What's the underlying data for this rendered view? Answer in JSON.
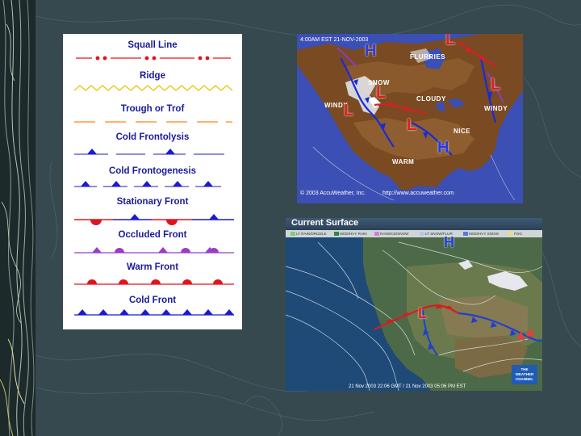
{
  "legend": {
    "items": [
      {
        "label": "Squall Line"
      },
      {
        "label": "Ridge"
      },
      {
        "label": "Trough or Trof"
      },
      {
        "label": "Cold Frontolysis"
      },
      {
        "label": "Cold Frontogenesis"
      },
      {
        "label": "Stationary Front"
      },
      {
        "label": "Occluded Front"
      },
      {
        "label": "Warm Front"
      },
      {
        "label": "Cold Front"
      }
    ],
    "colors": {
      "label": "#1a1a9a",
      "red": "#e0141e",
      "blue": "#1a1ad0",
      "purple": "#9a3cc8",
      "orange": "#ff9a3c",
      "yellow": "#e8c800"
    }
  },
  "map1": {
    "timestamp": "4:00AM EST 21-NOV-2003",
    "labels": [
      "FLURRIES",
      "SNOW",
      "WINDY",
      "CLOUDY",
      "WINDY",
      "NICE",
      "WARM"
    ],
    "copyright": "© 2003 AccuWeather, Inc.",
    "url": "http://www.accuweather.com",
    "pressure_symbols": [
      "H",
      "L",
      "L",
      "L",
      "L",
      "L",
      "H"
    ]
  },
  "map2": {
    "title": "Current Surface",
    "legend_items": [
      {
        "label": "LT RAIN/DRIZZLE",
        "color": "#7ad06e"
      },
      {
        "label": "MOD/HVY RAIN",
        "color": "#2c8a34"
      },
      {
        "label": "RAIN/ICE/SNOW",
        "color": "#d87ad8"
      },
      {
        "label": "LT SNOW/FLUR",
        "color": "#b0c8ee"
      },
      {
        "label": "MOD/HVY SNOW",
        "color": "#5a7ad8"
      },
      {
        "label": "FOG",
        "color": "#e8e07a"
      }
    ],
    "footer": "21 Nov 2003 22:06 GMT / 21 Nov 2003 05:06 PM EST",
    "logo_text": [
      "THE",
      "WEATHER",
      "CHANNEL"
    ],
    "pressure_symbols": [
      "H",
      "L"
    ]
  }
}
